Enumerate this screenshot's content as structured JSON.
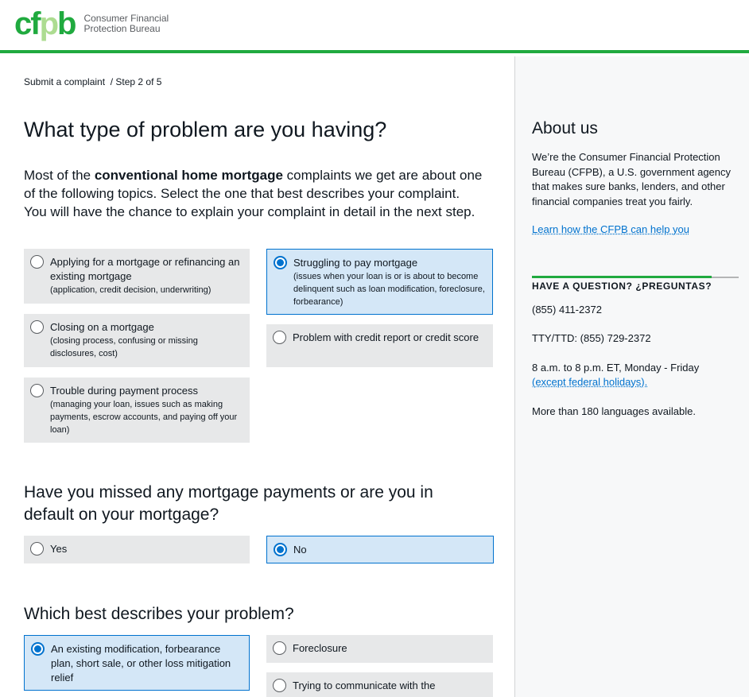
{
  "header": {
    "logo_mark_cf": "cf",
    "logo_mark_p": "p",
    "logo_mark_b": "b",
    "org_line1": "Consumer Financial",
    "org_line2": "Protection Bureau"
  },
  "breadcrumb": "Submit a complaint  / Step 2 of 5",
  "page_title": "What type of problem are you having?",
  "intro": {
    "before": "Most of the ",
    "bold": "conventional home mortgage",
    "after": " complaints we get are about one of the following topics. Select the one that best describes your complaint. You will have the chance to explain your complaint in detail in the next step."
  },
  "problem_options": [
    {
      "label": "Applying for a mortgage or refinancing an existing mortgage",
      "help": "(application, credit decision, underwriting)",
      "selected": false
    },
    {
      "label": "Struggling to pay mortgage",
      "help": "(issues when your loan is or is about to become delinquent such as loan modification, foreclosure, forbearance)",
      "selected": true
    },
    {
      "label": "Closing on a mortgage",
      "help": "(closing process, confusing or missing disclosures, cost)",
      "selected": false
    },
    {
      "label": "Problem with credit report or credit score",
      "help": "",
      "selected": false
    },
    {
      "label": "Trouble during payment process",
      "help": "(managing your loan, issues such as making payments, escrow accounts, and paying off your loan)",
      "selected": false
    }
  ],
  "missed_payments": {
    "question": "Have you missed any mortgage payments or are you in default on your mortgage?",
    "options": [
      {
        "label": "Yes",
        "selected": false
      },
      {
        "label": "No",
        "selected": true
      }
    ]
  },
  "describes_problem": {
    "question": "Which best describes your problem?",
    "options": [
      {
        "label": "An existing modification, forbearance plan, short sale, or other loss mitigation relief",
        "selected": true
      },
      {
        "label": "Foreclosure",
        "selected": false
      },
      {
        "label": "Trying to communicate with the",
        "selected": false
      }
    ]
  },
  "sidebar": {
    "about_title": "About us",
    "about_body": "We’re the Consumer Financial Protection Bureau (CFPB), a U.S. government agency that makes sure banks, lenders, and other financial companies treat you fairly.",
    "about_link": "Learn how the CFPB can help you",
    "question_title": "HAVE A QUESTION? ¿PREGUNTAS?",
    "phone": "(855) 411-2372",
    "tty": "TTY/TTD: (855) 729-2372",
    "hours": "8 a.m. to 8 p.m. ET, Monday - Friday",
    "holidays_link": "(except federal holidays).",
    "languages": "More than 180 languages available."
  },
  "colors": {
    "brand_green": "#20aa3f",
    "brand_light_green": "#addc91",
    "link_blue": "#0072ce",
    "selected_bg": "#d4e7f7",
    "option_bg": "#e7e8e9"
  }
}
